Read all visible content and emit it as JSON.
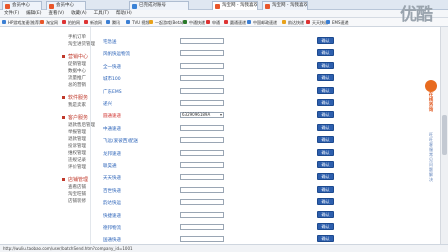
{
  "tabs": [
    {
      "label": "会员中心",
      "color": "#e8562a",
      "active": false
    },
    {
      "label": "会员中心",
      "color": "#e8562a",
      "active": false
    },
    {
      "label": "已完成对账号",
      "color": "#3a82d6",
      "active": false
    },
    {
      "label": "淘宝网 - 淘我喜欢！",
      "color": "#e8562a",
      "active": true
    },
    {
      "label": "淘宝网 - 淘我喜欢！",
      "color": "#e8562a",
      "active": false
    }
  ],
  "menu": [
    "文件(F)",
    "编辑(E)",
    "查看(V)",
    "收藏(A)",
    "工具(T)",
    "帮助(H)"
  ],
  "favorites": [
    {
      "label": "HP游戏加速(推荐)",
      "color": "#3b7fd4"
    },
    {
      "label": "淘宝网",
      "color": "#e8562a"
    },
    {
      "label": "拍拍网",
      "color": "#d33"
    },
    {
      "label": "新浪网",
      "color": "#d33"
    },
    {
      "label": "腾讯",
      "color": "#3b7fd4"
    },
    {
      "label": "TVU 视频",
      "color": "#3b7fd4"
    },
    {
      "label": "一起游戏(Beta)",
      "color": "#e8a21b"
    },
    {
      "label": "中通快递",
      "color": "#2a7a2a"
    },
    {
      "label": "申通",
      "color": "#d33"
    },
    {
      "label": "圆通速递",
      "color": "#d33"
    },
    {
      "label": "中国邮政速递",
      "color": "#3b7fd4"
    },
    {
      "label": "韵达快递",
      "color": "#e8a21b"
    },
    {
      "label": "天天快递",
      "color": "#d33"
    },
    {
      "label": "EMS速递",
      "color": "#3b7fd4"
    }
  ],
  "sidebar": {
    "sections": [
      {
        "title": "",
        "items": [
          "手机订单",
          "淘宝进货管理"
        ]
      },
      {
        "title": "营销中心",
        "items": [
          "促销管理",
          "数据中心",
          "流量推广",
          "总的营销"
        ]
      },
      {
        "title": "软件服务",
        "items": [
          "我是卖家"
        ]
      },
      {
        "title": "客户服务",
        "items": [
          "退款售后管理",
          "举报管理",
          "退款管理",
          "投诉管理",
          "维权管理",
          "违规记录",
          "评价管理"
        ]
      },
      {
        "title": "店铺管理",
        "items": [
          "查看店铺",
          "淘宝旺铺",
          "店铺装修"
        ]
      }
    ]
  },
  "rows": [
    {
      "label": "宅急送",
      "value": "",
      "red": false,
      "dropdown": false
    },
    {
      "label": "风帆快运物流",
      "value": "",
      "red": false,
      "dropdown": false
    },
    {
      "label": "全一快递",
      "value": "",
      "red": false,
      "dropdown": false
    },
    {
      "label": "城市100",
      "value": "",
      "red": false,
      "dropdown": false
    },
    {
      "label": "广东EMS",
      "value": "",
      "red": false,
      "dropdown": false
    },
    {
      "label": "递兴",
      "value": "",
      "red": false,
      "dropdown": false
    },
    {
      "label": "圆通速递",
      "value": "6329096189A",
      "red": true,
      "dropdown": true
    },
    {
      "label": "中通速递",
      "value": "",
      "red": false,
      "dropdown": false
    },
    {
      "label": "飞远(爱彼西)配送",
      "value": "",
      "red": false,
      "dropdown": false
    },
    {
      "label": "龙邦速递",
      "value": "",
      "red": false,
      "dropdown": false
    },
    {
      "label": "联昊通",
      "value": "",
      "red": false,
      "dropdown": false
    },
    {
      "label": "天天快递",
      "value": "",
      "red": false,
      "dropdown": false
    },
    {
      "label": "百世快递",
      "value": "",
      "red": false,
      "dropdown": false
    },
    {
      "label": "韵达快运",
      "value": "",
      "red": false,
      "dropdown": false
    },
    {
      "label": "快捷速递",
      "value": "",
      "red": false,
      "dropdown": false
    },
    {
      "label": "德邦物流",
      "value": "",
      "red": false,
      "dropdown": false
    },
    {
      "label": "国通快递",
      "value": "",
      "red": false,
      "dropdown": false
    }
  ],
  "confirm_label": "确认",
  "status_url": "http://wuliu.taobao.com/user/batchSend.htm?company_id=1001",
  "watermark": "优酷",
  "float_ad": {
    "title": "在线咨询",
    "vertical": "旺旺客服常见问题解决"
  }
}
